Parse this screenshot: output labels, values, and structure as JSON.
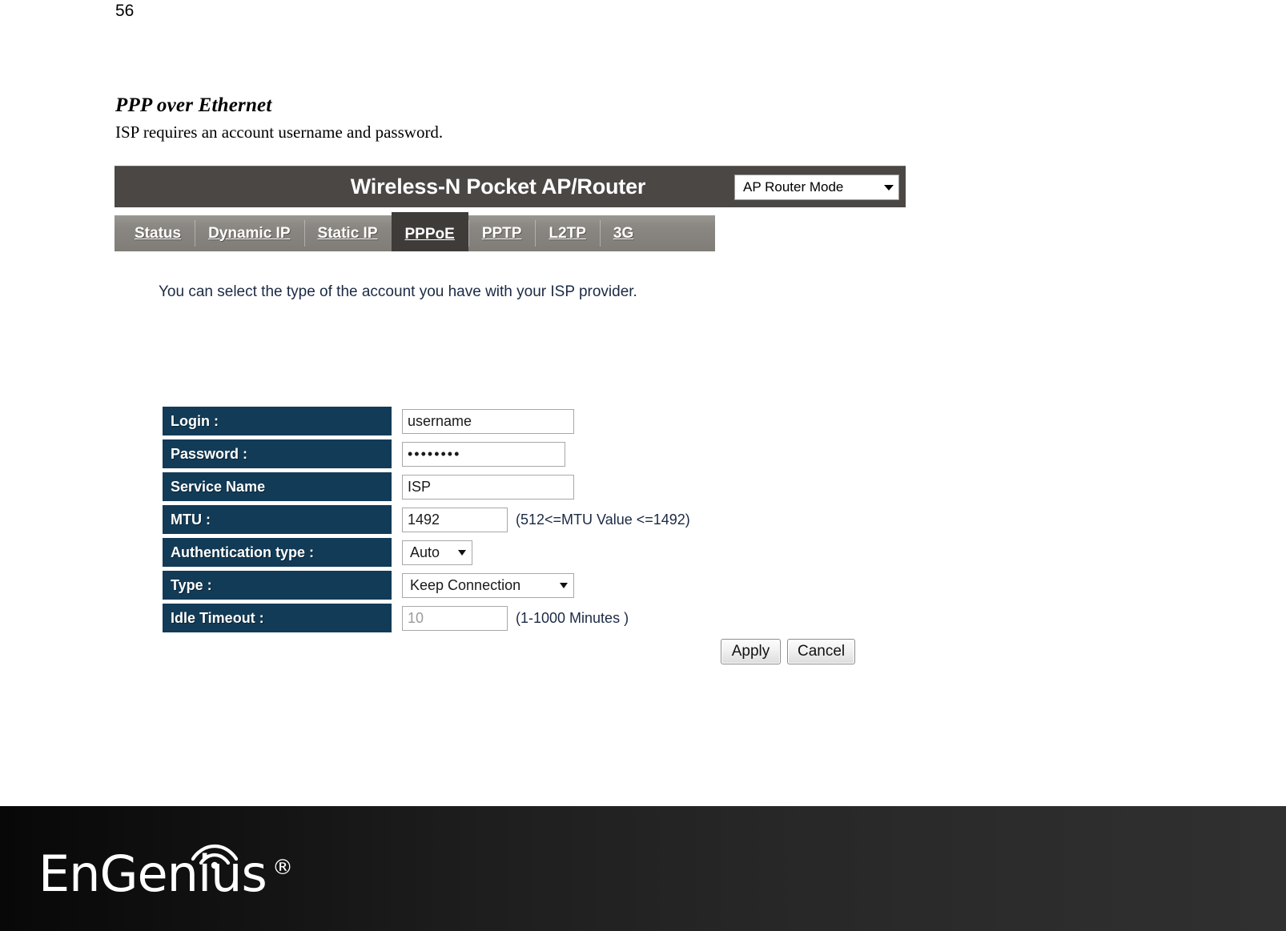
{
  "document": {
    "page_number": "56",
    "section_title": "PPP over Ethernet",
    "section_body": "ISP requires an account username and password."
  },
  "router_ui": {
    "header": {
      "title": "Wireless-N Pocket AP/Router",
      "mode_select": {
        "selected": "AP Router Mode",
        "icon": "chevron-down-icon"
      }
    },
    "tabs": [
      {
        "label": "Status",
        "active": false
      },
      {
        "label": "Dynamic IP",
        "active": false
      },
      {
        "label": "Static IP",
        "active": false
      },
      {
        "label": "PPPoE",
        "active": true
      },
      {
        "label": "PPTP",
        "active": false
      },
      {
        "label": "L2TP",
        "active": false
      },
      {
        "label": "3G",
        "active": false
      }
    ],
    "intro_text": "You can select the type of the account you have with your ISP provider.",
    "form": {
      "rows": [
        {
          "label": "Login :",
          "control": "text",
          "value": "username",
          "hint": ""
        },
        {
          "label": "Password :",
          "control": "password",
          "value": "••••••••",
          "hint": ""
        },
        {
          "label": "Service Name",
          "control": "text",
          "value": "ISP",
          "hint": ""
        },
        {
          "label": "MTU :",
          "control": "text",
          "value": "1492",
          "hint": "(512<=MTU Value  <=1492)"
        },
        {
          "label": "Authentication type :",
          "control": "select",
          "value": "Auto",
          "hint": ""
        },
        {
          "label": "Type :",
          "control": "select",
          "value": "Keep Connection",
          "hint": ""
        },
        {
          "label": "Idle Timeout :",
          "control": "text",
          "value": "",
          "placeholder": "10",
          "hint": "(1-1000 Minutes )"
        }
      ]
    },
    "buttons": {
      "apply": "Apply",
      "cancel": "Cancel"
    },
    "colors": {
      "header_bar": "#4a4745",
      "tab_bar": "#8a8782",
      "tab_active": "#3e3b39",
      "label_navy": "#123b57",
      "text_navy": "#1b2a44"
    }
  },
  "footer": {
    "brand_text": "EnGenius",
    "brand_registered": "®",
    "brand_icon": "wifi-signal-icon",
    "background_from": "#080808",
    "background_to": "#303030"
  }
}
